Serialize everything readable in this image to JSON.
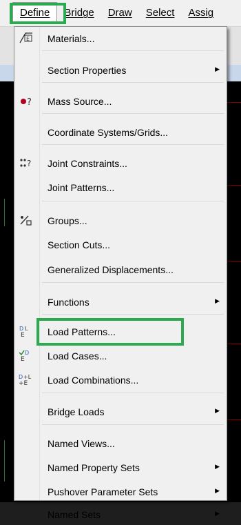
{
  "menubar": {
    "items": [
      {
        "label": "Define"
      },
      {
        "label": "Bridge"
      },
      {
        "label": "Draw"
      },
      {
        "label": "Select"
      },
      {
        "label": "Assig"
      }
    ]
  },
  "define_menu": {
    "items": [
      {
        "label": "Materials...",
        "icon": "materials-icon",
        "submenu": false
      },
      {
        "label": "Section Properties",
        "icon": "",
        "submenu": true
      },
      {
        "label": "Mass Source...",
        "icon": "mass-source-icon",
        "submenu": false
      },
      {
        "label": "Coordinate Systems/Grids...",
        "icon": "",
        "submenu": false
      },
      {
        "label": "Joint Constraints...",
        "icon": "joint-constraints-icon",
        "submenu": false
      },
      {
        "label": "Joint Patterns...",
        "icon": "",
        "submenu": false
      },
      {
        "label": "Groups...",
        "icon": "groups-icon",
        "submenu": false
      },
      {
        "label": "Section Cuts...",
        "icon": "",
        "submenu": false
      },
      {
        "label": "Generalized Displacements...",
        "icon": "",
        "submenu": false
      },
      {
        "label": "Functions",
        "icon": "",
        "submenu": true
      },
      {
        "label": "Load Patterns...",
        "icon": "load-patterns-icon",
        "submenu": false
      },
      {
        "label": "Load Cases...",
        "icon": "load-cases-icon",
        "submenu": false
      },
      {
        "label": "Load Combinations...",
        "icon": "load-combinations-icon",
        "submenu": false
      },
      {
        "label": "Bridge Loads",
        "icon": "",
        "submenu": true
      },
      {
        "label": "Named Views...",
        "icon": "",
        "submenu": false
      },
      {
        "label": "Named Property Sets",
        "icon": "",
        "submenu": true
      },
      {
        "label": "Pushover Parameter Sets",
        "icon": "",
        "submenu": true
      },
      {
        "label": "Named Sets",
        "icon": "",
        "submenu": true
      }
    ]
  },
  "highlight_color": "#2daa4f"
}
